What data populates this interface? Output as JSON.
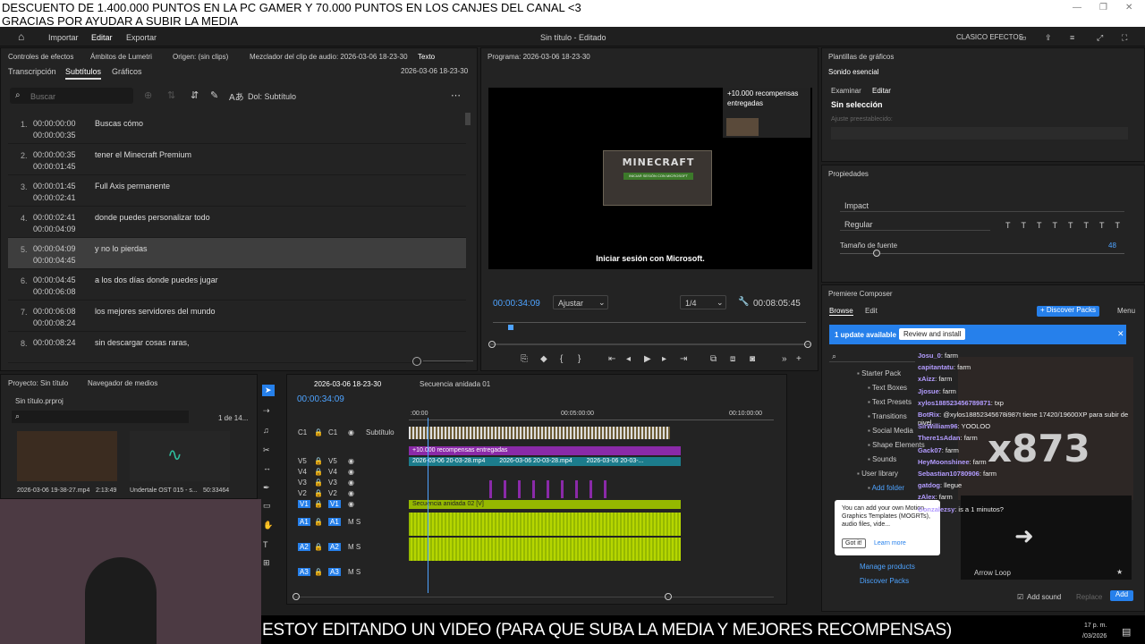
{
  "stream_overlay": {
    "top_line1": "DESCUENTO DE 1.400.000 PUNTOS EN LA PC GAMER Y 70.000 PUNTOS EN LOS CANJES DEL CANAL <3",
    "top_line2": "GRACIAS POR AYUDAR A SUBIR LA MEDIA",
    "bottom_text": "ESTOY EDITANDO UN VIDEO (PARA QUE SUBA LA MEDIA Y MEJORES RECOMPENSAS)",
    "clock_time": "17 p. m.",
    "clock_date": "/03/2026",
    "reward_line1": "+10.000 recompensas",
    "reward_line2": "entregadas",
    "watermark": "x873"
  },
  "menubar": {
    "home_icon": "home-icon",
    "items": [
      "Importar",
      "Editar",
      "Exportar"
    ],
    "project_title": "Sin título - Editado",
    "workspace": "CLASICO EFECTOS"
  },
  "source_panel": {
    "tabs": [
      "Controles de efectos",
      "Ámbitos de Lumetri",
      "Origen: (sin clips)",
      "Mezclador del clip de audio: 2026-03-06 18-23-30",
      "Texto"
    ],
    "subtabs": [
      "Transcripción",
      "Subtítulos",
      "Gráficos"
    ],
    "sequence_name": "2026-03-06 18-23-30",
    "search_placeholder": "Buscar",
    "track_label": "Dol: Subtítulo",
    "rows": [
      {
        "n": "1.",
        "start": "00:00:00:00",
        "end": "00:00:00:35",
        "text": "Buscas cómo"
      },
      {
        "n": "2.",
        "start": "00:00:00:35",
        "end": "00:00:01:45",
        "text": "tener el Minecraft Premium"
      },
      {
        "n": "3.",
        "start": "00:00:01:45",
        "end": "00:00:02:41",
        "text": "Full Axis permanente"
      },
      {
        "n": "4.",
        "start": "00:00:02:41",
        "end": "00:00:04:09",
        "text": "donde puedes personalizar todo"
      },
      {
        "n": "5.",
        "start": "00:00:04:09",
        "end": "00:00:04:45",
        "text": "y no lo pierdas"
      },
      {
        "n": "6.",
        "start": "00:00:04:45",
        "end": "00:00:06:08",
        "text": "a los dos días donde puedes jugar"
      },
      {
        "n": "7.",
        "start": "00:00:06:08",
        "end": "00:00:08:24",
        "text": "los mejores servidores del mundo"
      },
      {
        "n": "8.",
        "start": "00:00:08:24",
        "end": "",
        "text": "sin descargar cosas raras,"
      }
    ]
  },
  "program_monitor": {
    "title": "Programa: 2026-03-06 18-23-30",
    "caption": "Iniciar sesión con Microsoft.",
    "game_logo": "MINECRAFT",
    "game_button": "INICIAR SESIÓN CON MICROSOFT",
    "timecode": "00:00:34:09",
    "fit": "Ajustar",
    "resolution": "1/4",
    "duration": "00:08:05:45"
  },
  "essential_graphics": {
    "panel_title": "Plantillas de gráficos",
    "tab_title": "Sonido esencial",
    "tabs": [
      "Examinar",
      "Editar"
    ],
    "selection": "Sin selección",
    "preset_label": "Ajuste preestablecido:"
  },
  "properties": {
    "title": "Propiedades",
    "font": "Impact",
    "style": "Regular",
    "size_label": "Tamaño de fuente",
    "size_value": "48",
    "style_buttons": [
      "T",
      "T",
      "TT",
      "Tт",
      "T'",
      "T,",
      "T"
    ]
  },
  "composer": {
    "title": "Premiere Composer",
    "tabs": [
      "Browse",
      "Edit"
    ],
    "discover_btn": "+ Discover Packs",
    "menu": "Menu",
    "update_text": "1 update available",
    "update_btn": "Review and install",
    "library": [
      {
        "label": "Starter Pack",
        "indent": 0
      },
      {
        "label": "Text Boxes",
        "indent": 1
      },
      {
        "label": "Text Presets",
        "indent": 1
      },
      {
        "label": "Transitions",
        "indent": 1
      },
      {
        "label": "Social Media",
        "indent": 1
      },
      {
        "label": "Shape Elements",
        "indent": 1
      },
      {
        "label": "Sounds",
        "indent": 1
      },
      {
        "label": "User library",
        "indent": 0
      },
      {
        "label": "Add folder",
        "indent": 1
      }
    ],
    "tooltip_text": "You can add your own Motion Graphics Templates (MOGRTs), audio files, vide...",
    "tooltip_got": "Got it!",
    "tooltip_learn": "Learn more",
    "manage": "Manage products",
    "discover": "Discover Packs",
    "preview_label": "Arrow Loop",
    "add_sound": "Add sound",
    "replace": "Replace",
    "add": "Add"
  },
  "chat": [
    {
      "user": "Josu_0",
      "msg": ": farm"
    },
    {
      "user": "capitantatu",
      "msg": ": farm"
    },
    {
      "user": "xAizz",
      "msg": ": farm"
    },
    {
      "user": "Jjosue",
      "msg": ": farm"
    },
    {
      "user": "xylos188523456789871",
      "msg": ": txp"
    },
    {
      "user": "BotRix",
      "msg": ": @xylos18852345678i987t tiene 17420/19600XP para subir de nivel."
    },
    {
      "user": "SirWilliam96",
      "msg": ": YOOLOO"
    },
    {
      "user": "There1sAdan",
      "msg": ": farm"
    },
    {
      "user": "Gack07",
      "msg": ": farm"
    },
    {
      "user": "HeyMoonshinee",
      "msg": ": farm"
    },
    {
      "user": "Sebastian10780906",
      "msg": ": farm"
    },
    {
      "user": "gatdog",
      "msg": ": llegue"
    },
    {
      "user": "zAlex",
      "msg": ": farm"
    },
    {
      "user": "Gonzalezsy",
      "msg": ": is a 1 minutos?"
    }
  ],
  "project_panel": {
    "tabs": [
      "Proyecto: Sin título",
      "Navegador de medios"
    ],
    "file": "Sin título.prproj",
    "count": "1 de 14...",
    "items": [
      {
        "name": "2026-03-06 19-38-27.mp4",
        "dur": "2:13:49"
      },
      {
        "name": "Undertale OST 015 - s...",
        "dur": "50:33464"
      }
    ]
  },
  "timeline": {
    "tabs": [
      "2026-03-06 18-23-30",
      "Secuencia anidada 01"
    ],
    "timecode": "00:00:34:09",
    "ruler": [
      ":00:00",
      "00:05:00:00",
      "00:10:00:00"
    ],
    "tracks": [
      {
        "id": "C1",
        "name": "Subtítulo"
      },
      {
        "id": "V5",
        "name": ""
      },
      {
        "id": "V4",
        "name": ""
      },
      {
        "id": "V3",
        "name": ""
      },
      {
        "id": "V2",
        "name": ""
      },
      {
        "id": "V1",
        "name": ""
      },
      {
        "id": "A1",
        "name": ""
      },
      {
        "id": "A2",
        "name": ""
      },
      {
        "id": "A3",
        "name": ""
      }
    ],
    "clip_reward": "+10.000 recompensas entregadas",
    "clip_v5": [
      "2026-03-06 20-03-28.mp4",
      "2026-03-06 20-03-28.mp4",
      "2026-03-06 20-03-..."
    ],
    "clip_v1": "Secuencia anidada 02 [V]",
    "fx": "fx"
  },
  "colors": {
    "accent_blue": "#2680eb",
    "purple_clip": "#8a2aa8",
    "green_clip": "#95b800",
    "teal_clip": "#1c7c8c"
  }
}
